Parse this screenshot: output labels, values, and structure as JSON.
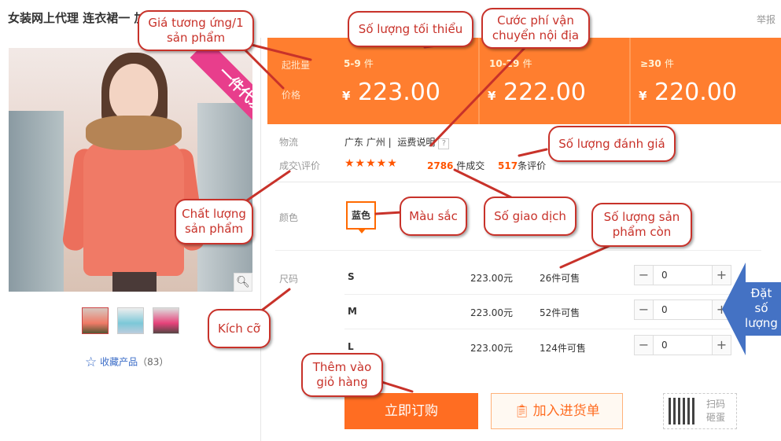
{
  "title": "女装网上代理 连衣裙一 加盟 微信女装代",
  "report_link": "举报",
  "ribbon_text": "一件代发",
  "favorite": {
    "label": "收藏产品",
    "count": "（83）"
  },
  "price_labels": {
    "moq": "起批量",
    "price": "价格"
  },
  "price_tiers": [
    {
      "range": "5-9",
      "unit": "件",
      "currency": "¥",
      "price": "223.00"
    },
    {
      "range": "10-29",
      "unit": "件",
      "currency": "¥",
      "price": "222.00"
    },
    {
      "range": "≥30",
      "unit": "件",
      "currency": "¥",
      "price": "220.00"
    }
  ],
  "logistics": {
    "label": "物流",
    "location": "广东 广州",
    "shipping_info": "运费说明",
    "help": "?"
  },
  "trade": {
    "label": "成交\\评价",
    "stars": "★★★★★",
    "count": "2786",
    "count_suffix": "件成交",
    "reviews": "517",
    "reviews_suffix": "条评价"
  },
  "color": {
    "label": "颜色",
    "selected": "蓝色"
  },
  "size": {
    "label": "尺码"
  },
  "skus": [
    {
      "size": "S",
      "price": "223.00元",
      "stock": "26件可售",
      "qty": "0"
    },
    {
      "size": "M",
      "price": "223.00元",
      "stock": "52件可售",
      "qty": "0"
    },
    {
      "size": "L",
      "price": "223.00元",
      "stock": "124件可售",
      "qty": "0"
    }
  ],
  "stepper": {
    "minus": "−",
    "plus": "+"
  },
  "actions": {
    "order": "立即订购",
    "add_cart": "加入进货单",
    "qr_text": "扫码砸蛋"
  },
  "annotations": {
    "unit_price": "Giá tương ứng/1 sản phẩm",
    "min_qty": "Số lượng tối thiểu",
    "shipping": "Cước phí vận chuyển nội địa",
    "review_count": "Số lượng đánh giá",
    "quality": "Chất lượng sản phẩm",
    "color": "Màu sắc",
    "transactions": "Số giao dịch",
    "stock": "Số lượng sản phẩm còn",
    "size": "Kích cỡ",
    "add_cart": "Thêm vào giỏ hàng",
    "order_qty": "Đặt số lượng"
  },
  "colors": {
    "accent": "#ff7e2f",
    "order_button": "#ff6d22",
    "callout": "#c8322a",
    "blue_arrow": "#4472c4"
  },
  "icons": {
    "zoom": "magnifier-icon",
    "favorite": "star-outline-icon",
    "cart": "clipboard-icon",
    "qr": "qr-code-icon"
  }
}
